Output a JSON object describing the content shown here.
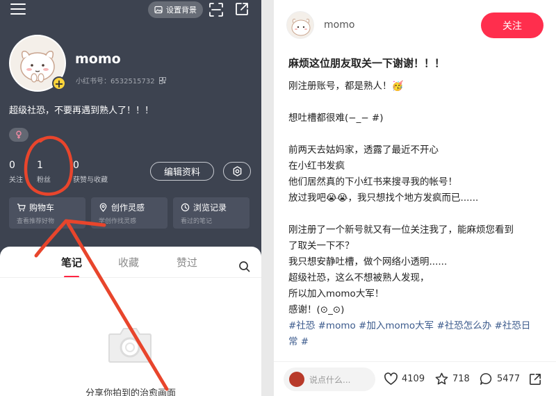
{
  "profile_screen": {
    "top_bar": {
      "set_background_label": "设置背景"
    },
    "username": "momo",
    "red_id": "小红书号：6532515732",
    "bio": "超级社恐，不要再遇到熟人了！！！",
    "stats": [
      {
        "value": "0",
        "label": "关注"
      },
      {
        "value": "1",
        "label": "粉丝"
      },
      {
        "value": "0",
        "label": "获赞与收藏"
      }
    ],
    "edit_profile_label": "编辑资料",
    "cards": [
      {
        "title": "购物车",
        "subtitle": "查看推荐好物",
        "icon": "cart-icon"
      },
      {
        "title": "创作灵感",
        "subtitle": "学创作找灵感",
        "icon": "bulb-icon"
      },
      {
        "title": "浏览记录",
        "subtitle": "看过的笔记",
        "icon": "clock-icon"
      }
    ],
    "tabs": [
      "笔记",
      "收藏",
      "赞过"
    ],
    "empty_state_text": "分享你拍到的治愈画面",
    "annotation_color": "#e8452c"
  },
  "post_screen": {
    "author": "momo",
    "follow_label": "关注",
    "title": "麻烦这位朋友取关一下谢谢！！！",
    "body_lines": [
      "刚注册账号，都是熟人！🥳",
      "",
      "想吐槽都很难(−_− #)",
      "",
      "前两天去姑妈家，透露了最近不开心",
      "在小红书发疯",
      "他们居然真的下小红书来搜寻我的帐号！",
      "放过我吧😭😭，我只想找个地方发疯而已......",
      "",
      "刚注册了一个新号就又有一位关注我了，能麻烦您看到",
      "了取关一下不？",
      "我只想安静吐槽，做个网络小透明......",
      "超级社恐，这么不想被熟人发现，",
      "所以加入momo大军！",
      "感谢！(⊙_⊙)"
    ],
    "tags_line1": "#社恐 #momo #加入momo大军 #社恐怎么办 #社恐日",
    "tags_line2": "常 #",
    "comment_placeholder": "说点什么...",
    "likes": "4109",
    "favorites": "718",
    "comments": "5477",
    "accent_color": "#ff2e4d"
  }
}
